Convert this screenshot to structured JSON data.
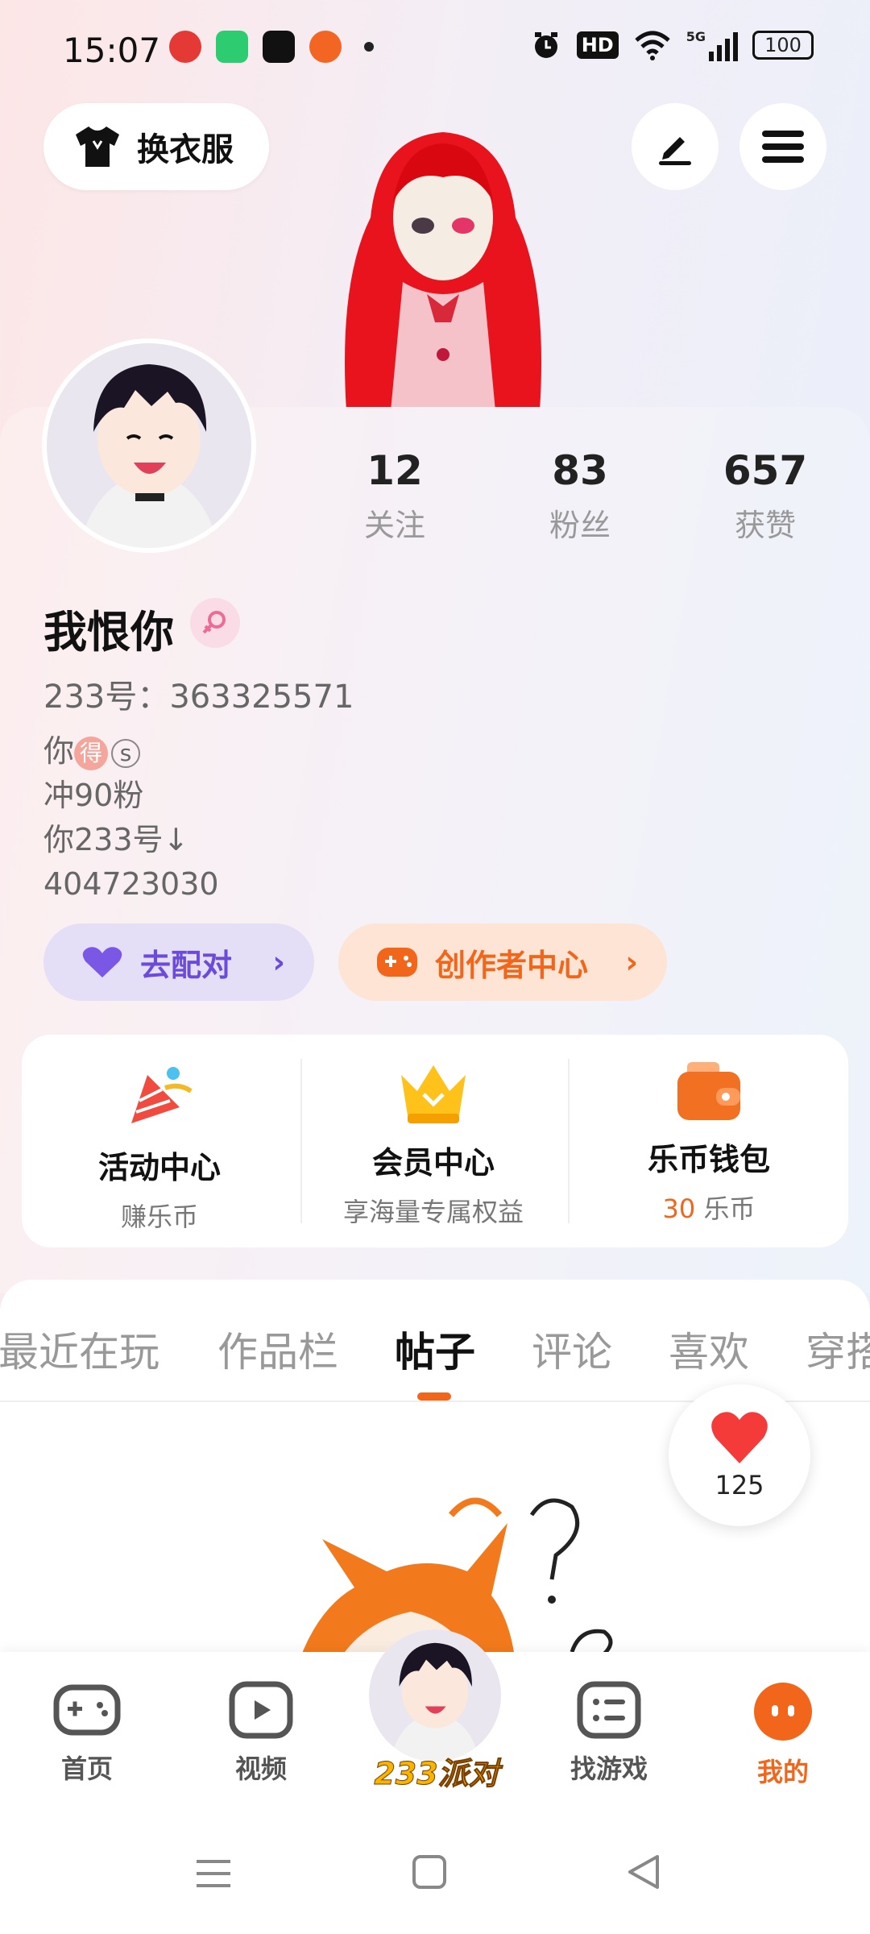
{
  "status_bar": {
    "time": "15:07",
    "battery": "100",
    "hd": "HD",
    "network": "5G"
  },
  "header": {
    "outfit_button": "换衣服"
  },
  "profile": {
    "stats": [
      {
        "value": "12",
        "label": "关注"
      },
      {
        "value": "83",
        "label": "粉丝"
      },
      {
        "value": "657",
        "label": "获赞"
      }
    ],
    "username": "我恨你",
    "uid": "233号：363325571",
    "bio_line1": "你",
    "bio_badge": "得",
    "bio_badge2": "s",
    "bio_line2": "冲90粉",
    "bio_line3": "你233号↓",
    "bio_line4": "404723030",
    "pair_button": "去配对",
    "creator_button": "创作者中心"
  },
  "features": [
    {
      "title": "活动中心",
      "subtitle": "赚乐币"
    },
    {
      "title": "会员中心",
      "subtitle": "享海量专属权益"
    },
    {
      "title": "乐币钱包",
      "subtitle_value": "30",
      "subtitle_unit": " 乐币"
    }
  ],
  "tabs": [
    "最近在玩",
    "作品栏",
    "帖子",
    "评论",
    "喜欢",
    "穿搭"
  ],
  "active_tab": "帖子",
  "like_count": "125",
  "bottom_nav": [
    {
      "label": "首页"
    },
    {
      "label": "视频"
    },
    {
      "label": "233派对"
    },
    {
      "label": "找游戏"
    },
    {
      "label": "我的"
    }
  ],
  "colors": {
    "accent": "#f2661c",
    "pair": "#6b4bd9"
  }
}
